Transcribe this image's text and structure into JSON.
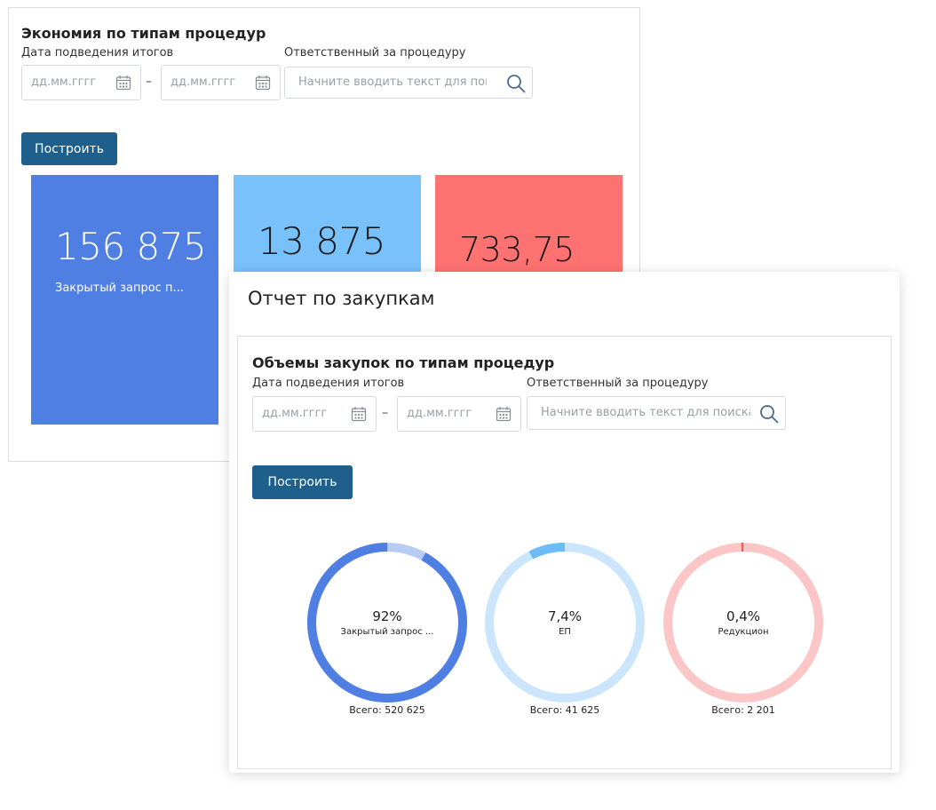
{
  "back": {
    "title": "Экономия по типам процедур",
    "date_label": "Дата подведения итогов",
    "responsible_label": "Ответственный за процедуру",
    "date_from_placeholder": "дд.мм.гггг",
    "date_to_placeholder": "дд.мм.гггг",
    "separator": "–",
    "search_placeholder": "Начните вводить текст для поиска",
    "build_label": "Построить",
    "tiles": [
      {
        "value": "156 875",
        "caption": "Закрытый запрос п...",
        "color": "#4f7fe3",
        "text_color": "#ffffff"
      },
      {
        "value": "13 875",
        "caption": "",
        "color": "#78c1fb",
        "text_color": "#1a1a1a"
      },
      {
        "value": "733,75",
        "caption": "",
        "color": "#ff7272",
        "text_color": "#1a1a1a"
      }
    ]
  },
  "front": {
    "header": "Отчет по закупкам",
    "title": "Объемы закупок по типам процедур",
    "date_label": "Дата подведения итогов",
    "responsible_label": "Ответственный за процедуру",
    "date_from_placeholder": "дд.мм.гггг",
    "date_to_placeholder": "дд.мм.гггг",
    "separator": "–",
    "search_placeholder": "Начните вводить текст для поиска",
    "build_label": "Построить",
    "donuts": [
      {
        "percent_label": "92%",
        "name": "Закрытый запрос ...",
        "total": "Всего: 520 625",
        "fraction": 0.92,
        "color": "#4f7fe3",
        "track": "#b8cbf3"
      },
      {
        "percent_label": "7,4%",
        "name": "ЕП",
        "total": "Всего: 41 625",
        "fraction": 0.074,
        "color": "#6cbcf7",
        "track": "#cbe6fc"
      },
      {
        "percent_label": "0,4%",
        "name": "Редукцион",
        "total": "Всего: 2 201",
        "fraction": 0.004,
        "color": "#ef5b5b",
        "track": "#fcc6c6"
      }
    ]
  },
  "icons": {
    "calendar": "calendar-icon",
    "search": "search-icon"
  }
}
